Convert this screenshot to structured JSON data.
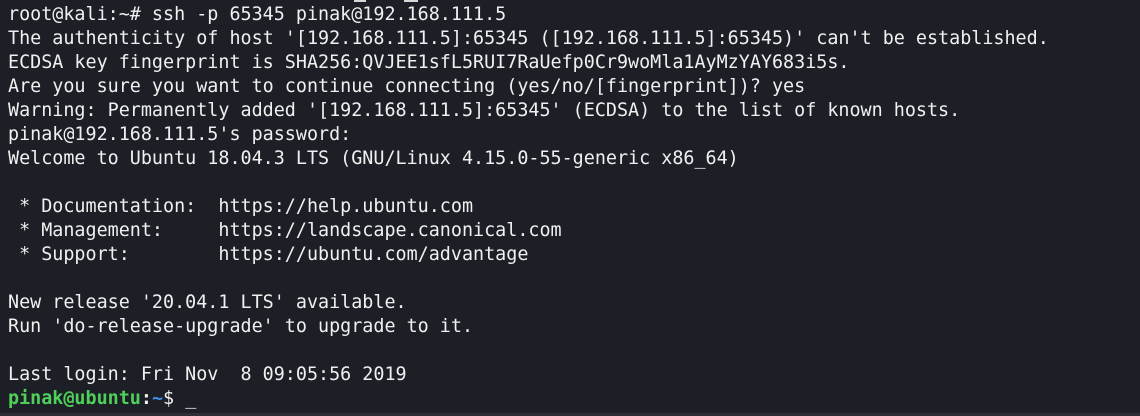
{
  "terminal": {
    "lines": [
      "root@kali:~# ssh -p 65345 pinak@192.168.111.5",
      "The authenticity of host '[192.168.111.5]:65345 ([192.168.111.5]:65345)' can't be established.",
      "ECDSA key fingerprint is SHA256:QVJEE1sfL5RUI7RaUefp0Cr9woMla1AyMzYAY683i5s.",
      "Are you sure you want to continue connecting (yes/no/[fingerprint])? yes",
      "Warning: Permanently added '[192.168.111.5]:65345' (ECDSA) to the list of known hosts.",
      "pinak@192.168.111.5's password:",
      "Welcome to Ubuntu 18.04.3 LTS (GNU/Linux 4.15.0-55-generic x86_64)",
      "",
      " * Documentation:  https://help.ubuntu.com",
      " * Management:     https://landscape.canonical.com",
      " * Support:        https://ubuntu.com/advantage",
      "",
      "New release '20.04.1 LTS' available.",
      "Run 'do-release-upgrade' to upgrade to it.",
      "",
      "Last login: Fri Nov  8 09:05:56 2019"
    ],
    "prompt": {
      "user_host": "pinak@ubuntu",
      "colon": ":",
      "path": "~",
      "sign": "$ ",
      "cursor": "_"
    },
    "colors": {
      "background": "#1c1f26",
      "foreground": "#f0f0f0",
      "prompt_user": "#4fd05a",
      "prompt_path": "#3b8eea"
    }
  }
}
